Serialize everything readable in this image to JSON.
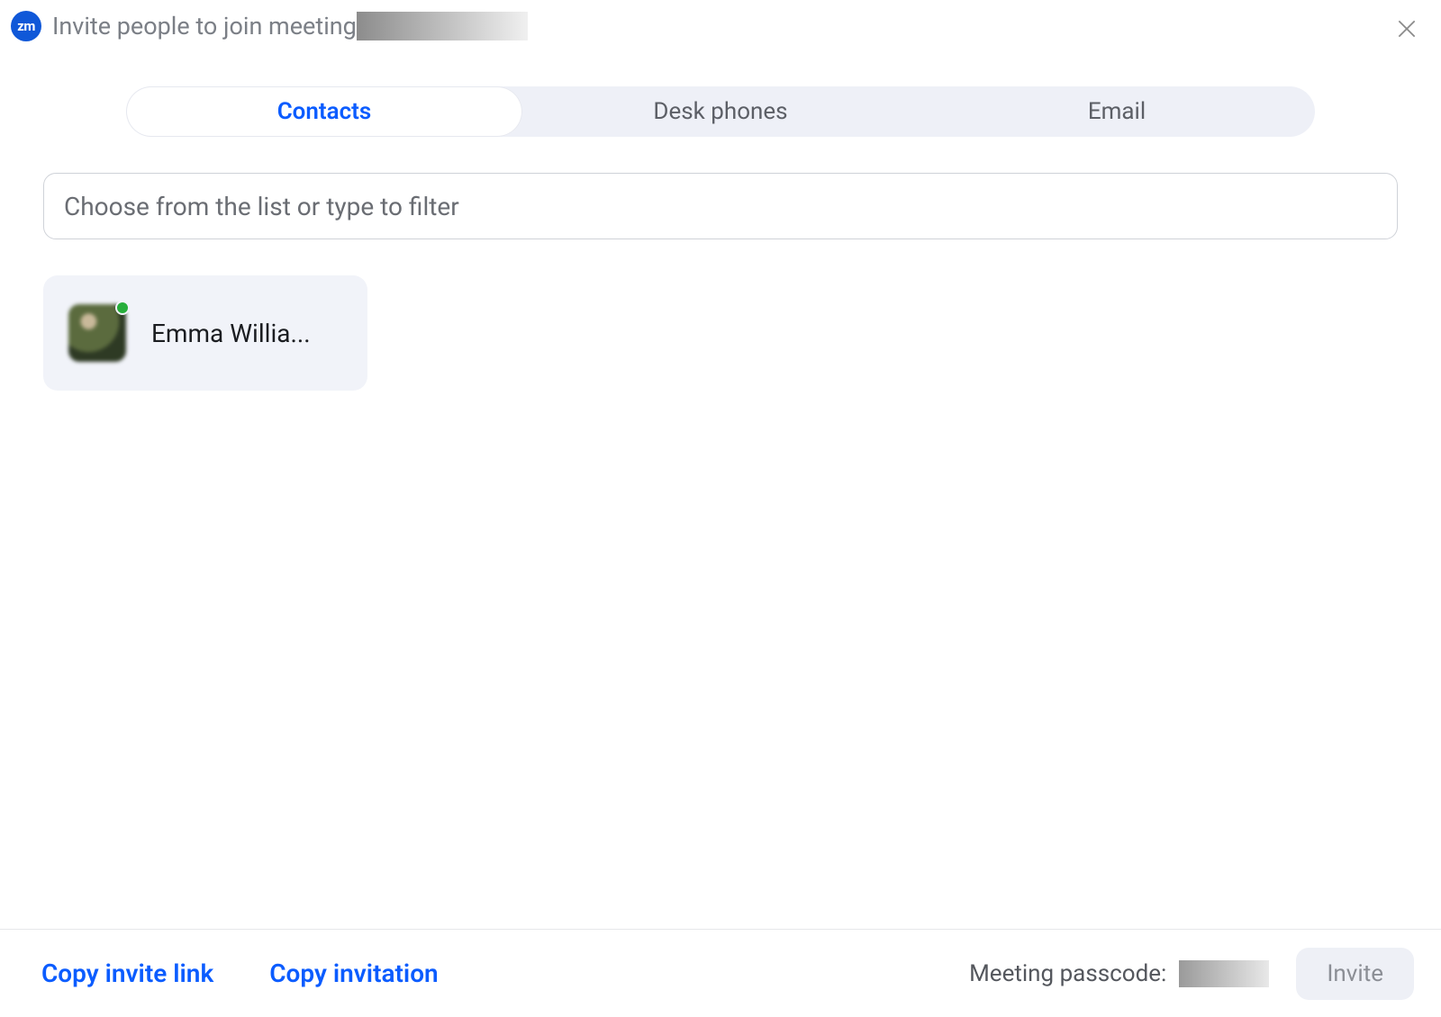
{
  "app_icon_text": "zm",
  "window": {
    "title": "Invite people to join meeting"
  },
  "tabs": {
    "contacts": "Contacts",
    "desk_phones": "Desk phones",
    "email": "Email"
  },
  "search": {
    "placeholder": "Choose from the list or type to filter",
    "value": ""
  },
  "contacts": [
    {
      "name": "Emma Willia...",
      "presence": "online"
    }
  ],
  "footer": {
    "copy_link": "Copy invite link",
    "copy_invitation": "Copy invitation",
    "passcode_label": "Meeting passcode:",
    "invite_button": "Invite"
  }
}
